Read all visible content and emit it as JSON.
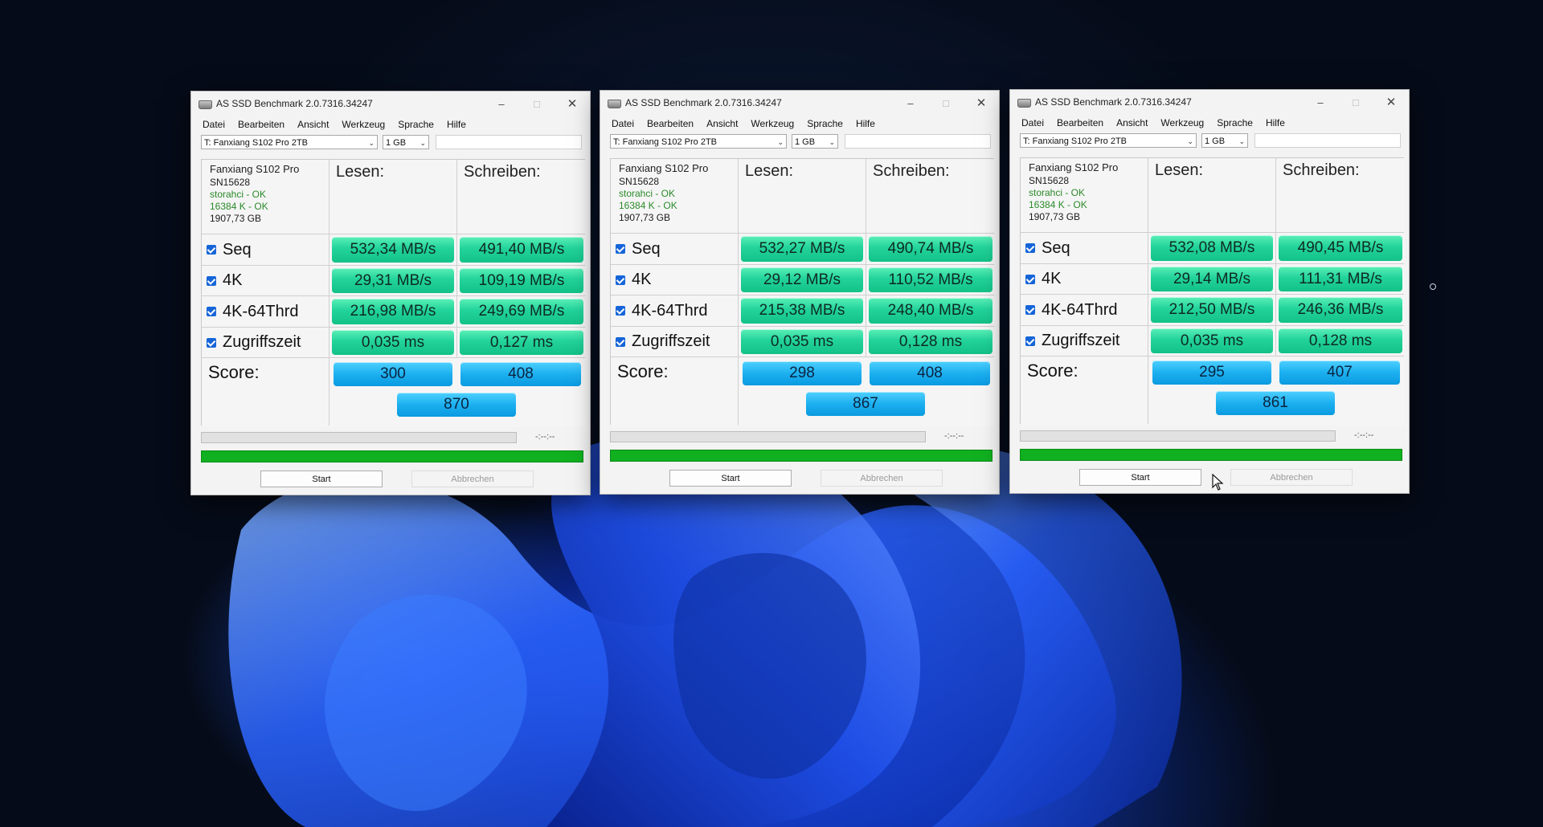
{
  "windows": [
    {
      "title": "AS SSD Benchmark 2.0.7316.34247",
      "menu": [
        "Datei",
        "Bearbeiten",
        "Ansicht",
        "Werkzeug",
        "Sprache",
        "Hilfe"
      ],
      "drive_select": "T: Fanxiang S102 Pro 2TB",
      "size_select": "1 GB",
      "info": {
        "name": "Fanxiang S102 Pro",
        "firmware": "SN15628",
        "driver": "storahci - OK",
        "alignment": "16384 K - OK",
        "capacity": "1907,73 GB"
      },
      "headers": {
        "read": "Lesen:",
        "write": "Schreiben:"
      },
      "rows": [
        {
          "label": "Seq",
          "read": "532,34 MB/s",
          "write": "491,40 MB/s"
        },
        {
          "label": "4K",
          "read": "29,31 MB/s",
          "write": "109,19 MB/s"
        },
        {
          "label": "4K-64Thrd",
          "read": "216,98 MB/s",
          "write": "249,69 MB/s"
        },
        {
          "label": "Zugriffszeit",
          "read": "0,035 ms",
          "write": "0,127 ms"
        }
      ],
      "score": {
        "label": "Score:",
        "read": "300",
        "write": "408",
        "total": "870"
      },
      "time": "-:--:--",
      "buttons": {
        "start": "Start",
        "abort": "Abbrechen"
      }
    },
    {
      "title": "AS SSD Benchmark 2.0.7316.34247",
      "menu": [
        "Datei",
        "Bearbeiten",
        "Ansicht",
        "Werkzeug",
        "Sprache",
        "Hilfe"
      ],
      "drive_select": "T: Fanxiang S102 Pro 2TB",
      "size_select": "1 GB",
      "info": {
        "name": "Fanxiang S102 Pro",
        "firmware": "SN15628",
        "driver": "storahci - OK",
        "alignment": "16384 K - OK",
        "capacity": "1907,73 GB"
      },
      "headers": {
        "read": "Lesen:",
        "write": "Schreiben:"
      },
      "rows": [
        {
          "label": "Seq",
          "read": "532,27 MB/s",
          "write": "490,74 MB/s"
        },
        {
          "label": "4K",
          "read": "29,12 MB/s",
          "write": "110,52 MB/s"
        },
        {
          "label": "4K-64Thrd",
          "read": "215,38 MB/s",
          "write": "248,40 MB/s"
        },
        {
          "label": "Zugriffszeit",
          "read": "0,035 ms",
          "write": "0,128 ms"
        }
      ],
      "score": {
        "label": "Score:",
        "read": "298",
        "write": "408",
        "total": "867"
      },
      "time": "-:--:--",
      "buttons": {
        "start": "Start",
        "abort": "Abbrechen"
      }
    },
    {
      "title": "AS SSD Benchmark 2.0.7316.34247",
      "menu": [
        "Datei",
        "Bearbeiten",
        "Ansicht",
        "Werkzeug",
        "Sprache",
        "Hilfe"
      ],
      "drive_select": "T: Fanxiang S102 Pro 2TB",
      "size_select": "1 GB",
      "info": {
        "name": "Fanxiang S102 Pro",
        "firmware": "SN15628",
        "driver": "storahci - OK",
        "alignment": "16384 K - OK",
        "capacity": "1907,73 GB"
      },
      "headers": {
        "read": "Lesen:",
        "write": "Schreiben:"
      },
      "rows": [
        {
          "label": "Seq",
          "read": "532,08 MB/s",
          "write": "490,45 MB/s"
        },
        {
          "label": "4K",
          "read": "29,14 MB/s",
          "write": "111,31 MB/s"
        },
        {
          "label": "4K-64Thrd",
          "read": "212,50 MB/s",
          "write": "246,36 MB/s"
        },
        {
          "label": "Zugriffszeit",
          "read": "0,035 ms",
          "write": "0,128 ms"
        }
      ],
      "score": {
        "label": "Score:",
        "read": "295",
        "write": "407",
        "total": "861"
      },
      "time": "-:--:--",
      "buttons": {
        "start": "Start",
        "abort": "Abbrechen"
      }
    }
  ],
  "colors": {
    "value_green": "#22d39a",
    "score_blue": "#1cb0f0",
    "progress_green": "#10b020",
    "ok_text": "#2a8a2a"
  }
}
